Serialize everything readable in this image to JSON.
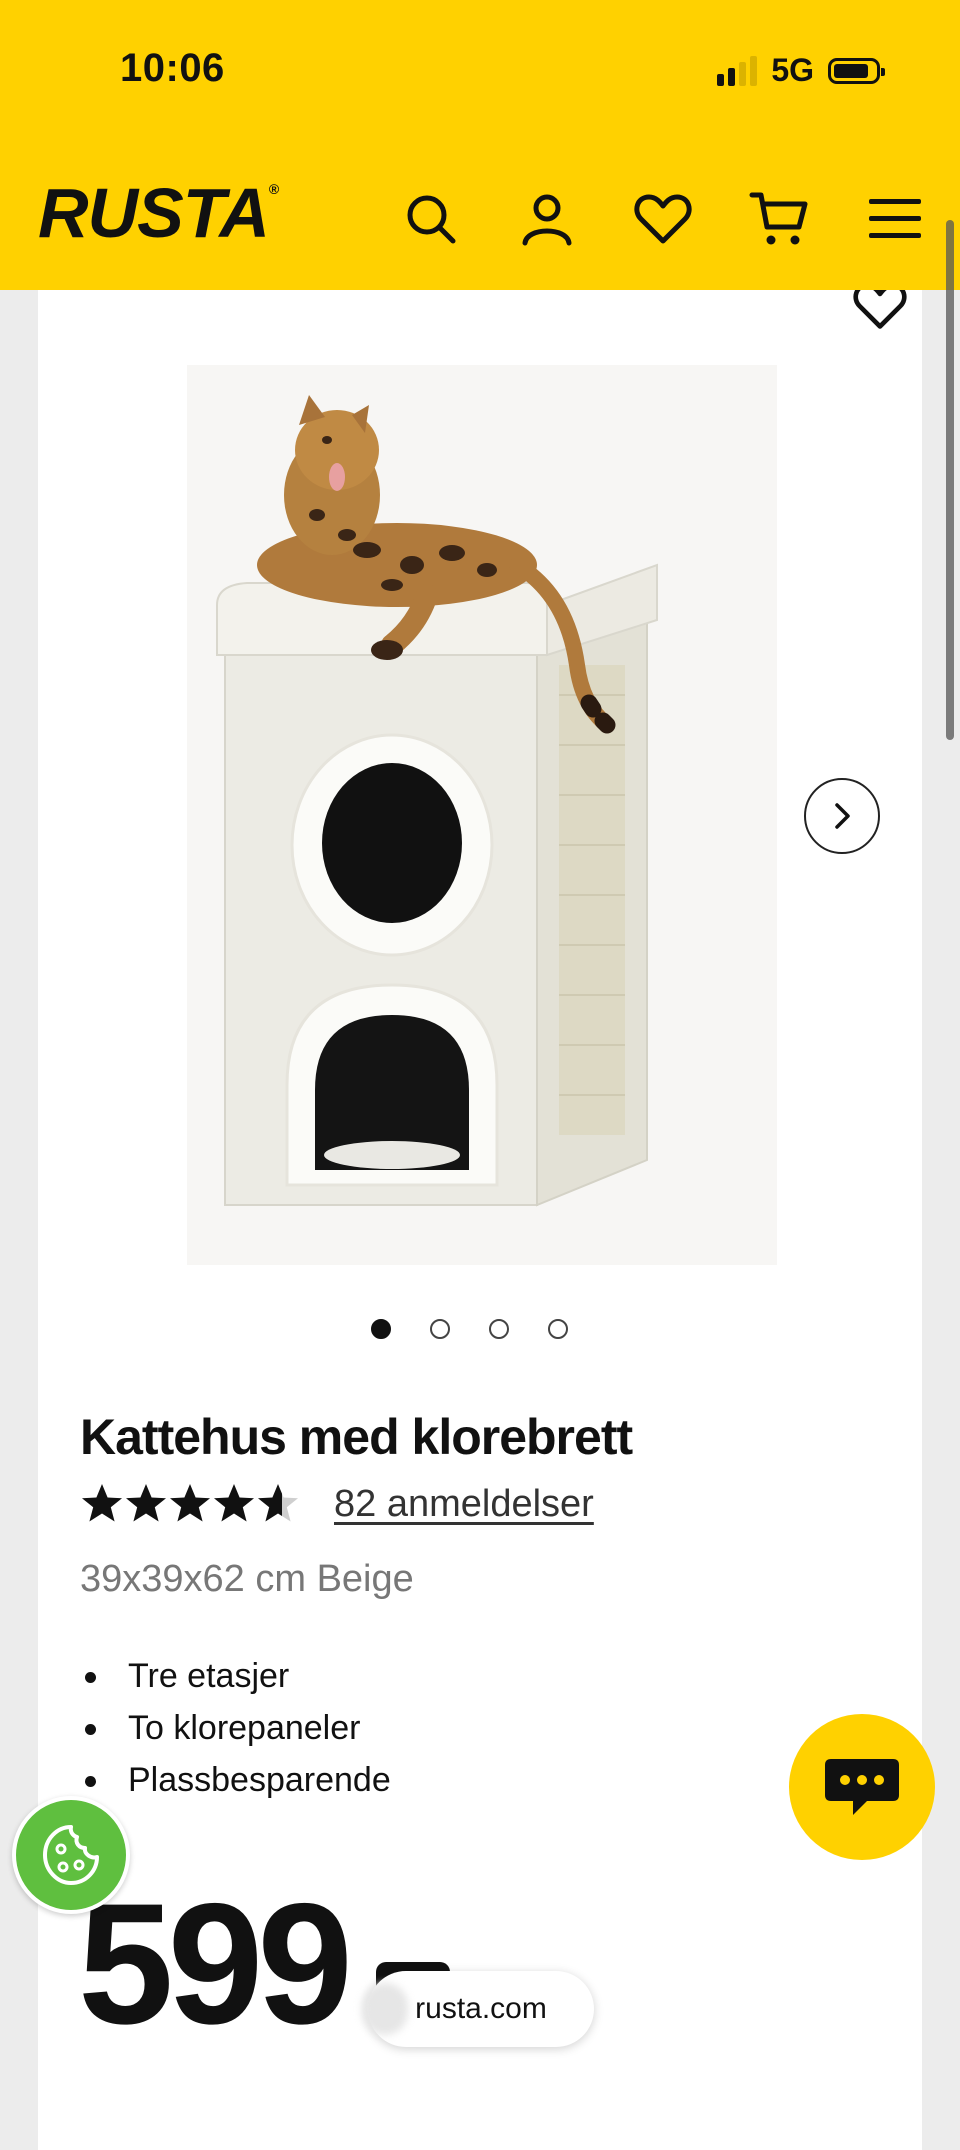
{
  "status_bar": {
    "time": "10:06",
    "network": "5G"
  },
  "header": {
    "logo": "RUSTA",
    "logo_mark": "®"
  },
  "product": {
    "title": "Kattehus med klorebrett",
    "rating": 4.5,
    "reviews": "82 anmeldelser",
    "variant": "39x39x62 cm Beige",
    "features": [
      "Tre etasjer",
      "To klorepaneler",
      "Plassbesparende"
    ],
    "price": "599",
    "image_count": 4,
    "active_image": 1
  },
  "browser": {
    "url": "rusta.com"
  },
  "colors": {
    "brand_yellow": "#ffd100",
    "cookie_green": "#5fbf3f"
  },
  "icons": [
    "search-icon",
    "user-icon",
    "heart-icon",
    "cart-icon",
    "menu-icon",
    "chevron-right-icon",
    "chat-icon",
    "cookie-icon"
  ]
}
